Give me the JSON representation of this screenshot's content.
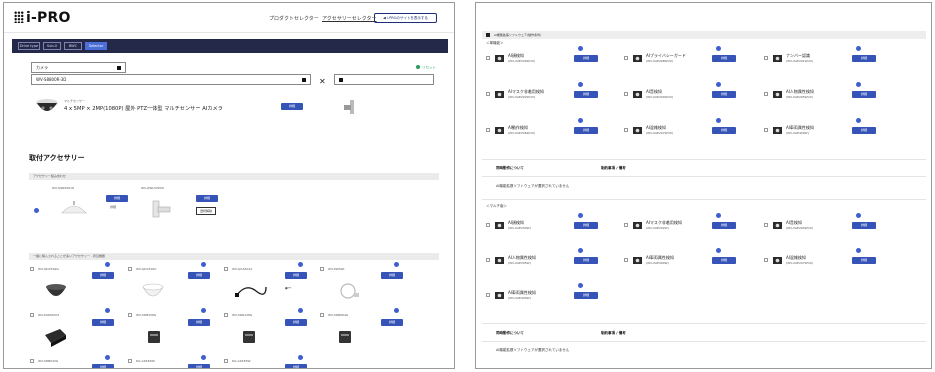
{
  "left": {
    "logo": "PRO",
    "nav": {
      "product_selector": "プロダクトセレクター",
      "accessory_selector": "アクセサリーセレクター",
      "site_button": "◀ i-PROのサイトを表示する"
    },
    "tabs": [
      "Drive type",
      "Sub-0",
      "BWC",
      "Selector"
    ],
    "camera_select": "カメラ",
    "reset": "リセット",
    "model_select": "WV-S8800R-3D",
    "second_select": "",
    "camera": {
      "subtitle": "マルチセンサー",
      "title": "4 x 5MP × 2MP(1080P) 屋外 PTZ一体型 マルチセンサー AIカメラ",
      "button": "詳細"
    },
    "section_title": "取付アクセサリー",
    "group1_bar": "アクセサリー組み合わせ",
    "group1": [
      {
        "name": "WV-QSR508-W",
        "btn": "詳細",
        "link": "詳細"
      },
      {
        "name": "WV-QWL509UX",
        "btn": "詳細",
        "select": "選択解除"
      }
    ],
    "group2_bar": "一緒に購入されることが多いアクセサリー - 周辺機器",
    "grid": [
      {
        "name": "WV-QDC502G"
      },
      {
        "name": "WV-QDC502C"
      },
      {
        "name": "WV-QCA501A"
      },
      {
        "name": "WV-PWS00"
      },
      {
        "name": "WV-PL6000UX"
      },
      {
        "name": "WV-SDB256G"
      },
      {
        "name": "WV-SDR128G"
      },
      {
        "name": "WV-SDB064G"
      },
      {
        "name": "WV-SDB032G"
      },
      {
        "name": "DG-AZ1EDW"
      },
      {
        "name": "DG-AZ1ESW"
      }
    ],
    "grid_button": "詳細"
  },
  "right": {
    "top_bar": "AI機能拡張ソフトウェア(動作条件)",
    "group_single": "＜単機能＞",
    "single_items": [
      {
        "name": "AI顔検知",
        "model": "(WV-XAE200WUX)"
      },
      {
        "name": "AIプライバシーガード",
        "model": "(WV-XAE208WUX)"
      },
      {
        "name": "ナンバー認識",
        "model": "(WV-XAE201WUX)"
      },
      {
        "name": "AIマスク非着用検知",
        "model": "(WV-XAE202WUX)"
      },
      {
        "name": "AI音検知",
        "model": "(WV-XAE204WUX)"
      },
      {
        "name": "AI人物属性検知",
        "model": "(WV-XAE205WUX)"
      },
      {
        "name": "AI動作検知",
        "model": "(WV-XAE206WUX)"
      },
      {
        "name": "AI混雑検知",
        "model": "(WV-XAE207WUX)"
      },
      {
        "name": "AI車両属性検知",
        "model": "(WV-XAE400W)"
      }
    ],
    "notes_head_1": "同時動作について",
    "notes_head_2": "制約事項 / 備考",
    "note_text": "AI機能拡張ソフトウェアが選択されていません",
    "group_multi": "＜マルチ版＞",
    "multi_items": [
      {
        "name": "AI顔検知",
        "model": "(WV-XAE200W)"
      },
      {
        "name": "AIマスク非着用検知",
        "model": "(WV-XAE202W)"
      },
      {
        "name": "AI音検知",
        "model": "(WV-XAE204WUX)"
      },
      {
        "name": "AI人物属性検知",
        "model": "(WV-XAE205W)"
      },
      {
        "name": "AI車両属性検知",
        "model": "(WV-XAE400W)"
      },
      {
        "name": "AI混雑検知",
        "model": "(WV-XAE207WUX)"
      },
      {
        "name": "AI車両属性検知",
        "model": "(WV-XAE400W)"
      }
    ],
    "item_button": "詳細"
  }
}
